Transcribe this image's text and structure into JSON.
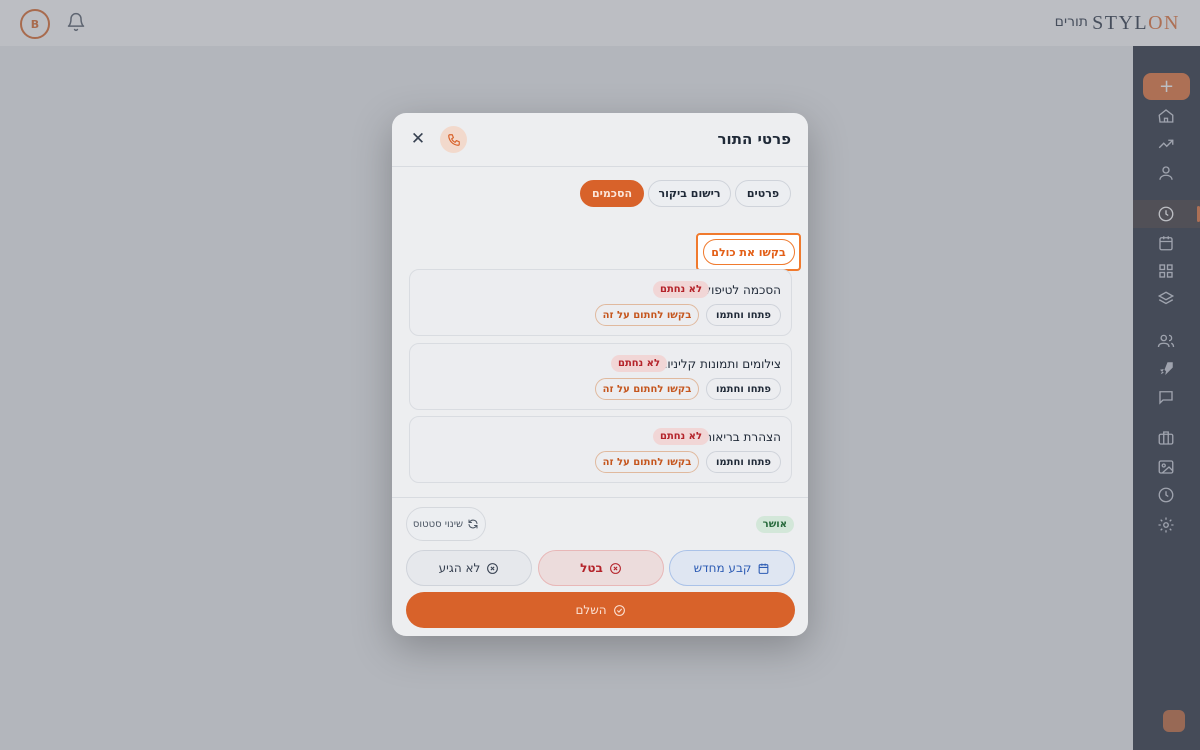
{
  "app": {
    "logo_main": "STYL",
    "logo_accent": "ON",
    "page_title": "תורים",
    "avatar_initial": "B"
  },
  "sidebar": {
    "add_label": "+",
    "items": [
      "home-icon",
      "trending-icon",
      "user-icon",
      "clock-icon",
      "calendar-icon",
      "grid-icon",
      "layers-icon",
      "users-icon",
      "rocket-icon",
      "chat-icon",
      "briefcase-icon",
      "image-icon",
      "history-icon",
      "settings-icon"
    ],
    "active_item": "clock-icon"
  },
  "modal": {
    "title": "פרטי התור",
    "tabs": [
      {
        "label": "פרטים",
        "active": false
      },
      {
        "label": "רישום ביקור",
        "active": false
      },
      {
        "label": "הסכמים",
        "active": true
      }
    ],
    "request_all_label": "בקשו את כולם",
    "consents": [
      {
        "title": "הסכמה לטיפול",
        "status": "לא נחתם",
        "open_label": "פתחו וחתמו",
        "request_label": "בקשו לחתום על זה"
      },
      {
        "title": "צילומים ותמונות קליניות",
        "status": "לא נחתם",
        "open_label": "פתחו וחתמו",
        "request_label": "בקשו לחתום על זה"
      },
      {
        "title": "הצהרת בריאות",
        "status": "לא נחתם",
        "open_label": "פתחו וחתמו",
        "request_label": "בקשו לחתום על זה"
      }
    ],
    "status_badge": "אושר",
    "change_status_label": "שינוי סטטוס",
    "actions": {
      "no_show": "לא הגיע",
      "cancel": "בטל",
      "reschedule": "קבע מחדש",
      "complete": "השלם"
    }
  },
  "colors": {
    "accent": "#e36a2c",
    "sidebar_bg": "#1b2433",
    "unsigned_badge": "#b4232a",
    "approved_badge": "#276a3c",
    "reschedule": "#2d5cb4"
  }
}
